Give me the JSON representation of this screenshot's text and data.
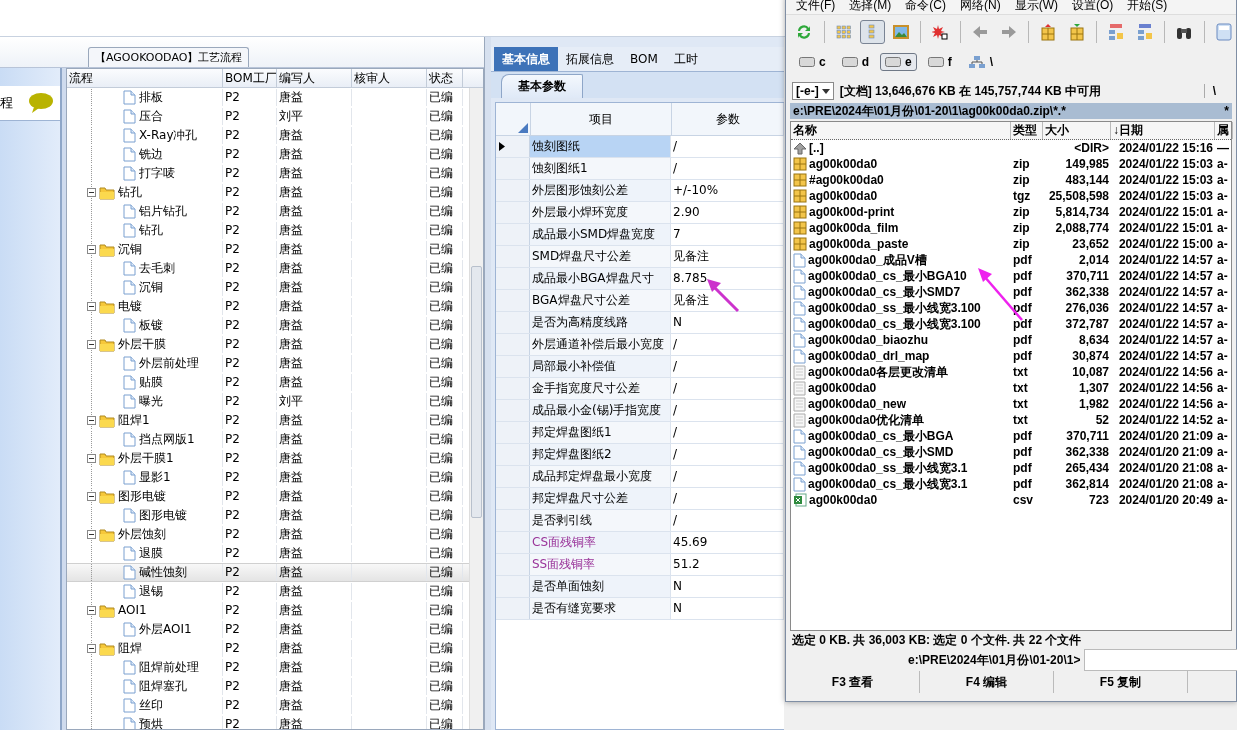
{
  "process_panel": {
    "group_title": "【AGOOKOODAO】工艺流程",
    "side_label": "程",
    "columns": [
      "流程",
      "BOM工厂",
      "编写人",
      "核审人",
      "状态"
    ],
    "tree": [
      {
        "children": [
          {
            "label": "排板",
            "bom": "P2",
            "author": "唐益",
            "status": "已编",
            "selected": false
          },
          {
            "label": "压合",
            "bom": "P2",
            "author": "刘平",
            "status": "已编",
            "selected": false
          },
          {
            "label": "X-Ray冲孔",
            "bom": "P2",
            "author": "唐益",
            "status": "已编",
            "selected": false
          },
          {
            "label": "铣边",
            "bom": "P2",
            "author": "唐益",
            "status": "已编",
            "selected": false
          },
          {
            "label": "打字唛",
            "bom": "P2",
            "author": "唐益",
            "status": "已编",
            "selected": false
          }
        ]
      },
      {
        "label": "钻孔",
        "bom": "P2",
        "author": "唐益",
        "status": "已编",
        "selected": false,
        "expanded": true,
        "children": [
          {
            "label": "铝片钻孔",
            "bom": "P2",
            "author": "唐益",
            "status": "已编",
            "selected": false
          },
          {
            "label": "钻孔",
            "bom": "P2",
            "author": "唐益",
            "status": "已编",
            "selected": false
          }
        ]
      },
      {
        "label": "沉铜",
        "bom": "P2",
        "author": "唐益",
        "status": "已编",
        "selected": false,
        "expanded": true,
        "children": [
          {
            "label": "去毛刺",
            "bom": "P2",
            "author": "唐益",
            "status": "已编",
            "selected": false
          },
          {
            "label": "沉铜",
            "bom": "P2",
            "author": "唐益",
            "status": "已编",
            "selected": false
          }
        ]
      },
      {
        "label": "电镀",
        "bom": "P2",
        "author": "唐益",
        "status": "已编",
        "selected": false,
        "expanded": true,
        "children": [
          {
            "label": "板镀",
            "bom": "P2",
            "author": "唐益",
            "status": "已编",
            "selected": false
          }
        ]
      },
      {
        "label": "外层干膜",
        "bom": "P2",
        "author": "唐益",
        "status": "已编",
        "selected": false,
        "expanded": true,
        "children": [
          {
            "label": "外层前处理",
            "bom": "P2",
            "author": "唐益",
            "status": "已编",
            "selected": false
          },
          {
            "label": "贴膜",
            "bom": "P2",
            "author": "唐益",
            "status": "已编",
            "selected": false
          },
          {
            "label": "曝光",
            "bom": "P2",
            "author": "刘平",
            "status": "已编",
            "selected": false
          }
        ]
      },
      {
        "label": "阻焊1",
        "bom": "P2",
        "author": "唐益",
        "status": "已编",
        "selected": false,
        "expanded": true,
        "children": [
          {
            "label": "挡点网版1",
            "bom": "P2",
            "author": "唐益",
            "status": "已编",
            "selected": false
          }
        ]
      },
      {
        "label": "外层干膜1",
        "bom": "P2",
        "author": "唐益",
        "status": "已编",
        "selected": false,
        "expanded": true,
        "children": [
          {
            "label": "显影1",
            "bom": "P2",
            "author": "唐益",
            "status": "已编",
            "selected": false
          }
        ]
      },
      {
        "label": "图形电镀",
        "bom": "P2",
        "author": "唐益",
        "status": "已编",
        "selected": false,
        "expanded": true,
        "children": [
          {
            "label": "图形电镀",
            "bom": "P2",
            "author": "唐益",
            "status": "已编",
            "selected": false
          }
        ]
      },
      {
        "label": "外层蚀刻",
        "bom": "P2",
        "author": "唐益",
        "status": "已编",
        "selected": false,
        "expanded": true,
        "children": [
          {
            "label": "退膜",
            "bom": "P2",
            "author": "唐益",
            "status": "已编",
            "selected": false
          },
          {
            "label": "碱性蚀刻",
            "bom": "P2",
            "author": "唐益",
            "status": "已编",
            "selected": true
          },
          {
            "label": "退锡",
            "bom": "P2",
            "author": "唐益",
            "status": "已编",
            "selected": false
          }
        ]
      },
      {
        "label": "AOI1",
        "bom": "P2",
        "author": "唐益",
        "status": "已编",
        "selected": false,
        "expanded": true,
        "children": [
          {
            "label": "外层AOI1",
            "bom": "P2",
            "author": "唐益",
            "status": "已编",
            "selected": false
          }
        ]
      },
      {
        "label": "阻焊",
        "bom": "P2",
        "author": "唐益",
        "status": "已编",
        "selected": false,
        "expanded": true,
        "children": [
          {
            "label": "阻焊前处理",
            "bom": "P2",
            "author": "唐益",
            "status": "已编",
            "selected": false
          },
          {
            "label": "阻焊塞孔",
            "bom": "P2",
            "author": "唐益",
            "status": "已编",
            "selected": false
          },
          {
            "label": "丝印",
            "bom": "P2",
            "author": "唐益",
            "status": "已编",
            "selected": false
          },
          {
            "label": "预烘",
            "bom": "P2",
            "author": "唐益",
            "status": "已编",
            "selected": false
          }
        ]
      }
    ]
  },
  "info_panel": {
    "tabs": [
      {
        "label": "基本信息",
        "selected": true
      },
      {
        "label": "拓展信息",
        "selected": false
      },
      {
        "label": "BOM",
        "selected": false
      },
      {
        "label": "工时",
        "selected": false
      }
    ],
    "subtab": "基本参数",
    "columns": [
      "项目",
      "参数"
    ],
    "rows": [
      {
        "item": "蚀刻图纸",
        "value": "/",
        "selected": true,
        "kind": "normal"
      },
      {
        "item": "蚀刻图纸1",
        "value": "/",
        "selected": false,
        "kind": "normal"
      },
      {
        "item": "外层图形蚀刻公差",
        "value": "+/-10%",
        "selected": false,
        "kind": "normal"
      },
      {
        "item": "外层最小焊环宽度",
        "value": "2.90",
        "selected": false,
        "kind": "normal"
      },
      {
        "item": "成品最小SMD焊盘宽度",
        "value": "7",
        "selected": false,
        "kind": "normal"
      },
      {
        "item": "SMD焊盘尺寸公差",
        "value": "见备注",
        "selected": false,
        "kind": "normal"
      },
      {
        "item": "成品最小BGA焊盘尺寸",
        "value": "8.785",
        "selected": false,
        "kind": "normal"
      },
      {
        "item": "BGA焊盘尺寸公差",
        "value": "见备注",
        "selected": false,
        "kind": "normal"
      },
      {
        "item": "是否为高精度线路",
        "value": "N",
        "selected": false,
        "kind": "normal"
      },
      {
        "item": "外层通道补偿后最小宽度",
        "value": "/",
        "selected": false,
        "kind": "normal"
      },
      {
        "item": "局部最小补偿值",
        "value": "/",
        "selected": false,
        "kind": "normal"
      },
      {
        "item": "金手指宽度尺寸公差",
        "value": "/",
        "selected": false,
        "kind": "normal"
      },
      {
        "item": "成品最小金(锡)手指宽度",
        "value": "/",
        "selected": false,
        "kind": "normal"
      },
      {
        "item": "邦定焊盘图纸1",
        "value": "/",
        "selected": false,
        "kind": "normal"
      },
      {
        "item": "邦定焊盘图纸2",
        "value": "/",
        "selected": false,
        "kind": "normal"
      },
      {
        "item": "成品邦定焊盘最小宽度",
        "value": "/",
        "selected": false,
        "kind": "normal"
      },
      {
        "item": "邦定焊盘尺寸公差",
        "value": "/",
        "selected": false,
        "kind": "normal"
      },
      {
        "item": "是否剥引线",
        "value": "/",
        "selected": false,
        "kind": "normal"
      },
      {
        "item": "CS面残铜率",
        "value": "45.69",
        "selected": false,
        "kind": "highlighted"
      },
      {
        "item": "SS面残铜率",
        "value": "51.2",
        "selected": false,
        "kind": "highlighted"
      },
      {
        "item": "是否单面蚀刻",
        "value": "N",
        "selected": false,
        "kind": "normal"
      },
      {
        "item": "是否有缝宽要求",
        "value": "N",
        "selected": false,
        "kind": "normal"
      }
    ]
  },
  "file_manager": {
    "menu": [
      "文件(F)",
      "选择(M)",
      "命令(C)",
      "网络(N)",
      "显示(W)",
      "设置(O)",
      "开始(S)"
    ],
    "toolbar": [
      {
        "kind": "refresh",
        "pressed": false
      },
      {
        "kind": "sep"
      },
      {
        "kind": "grid",
        "pressed": false
      },
      {
        "kind": "list",
        "pressed": true
      },
      {
        "kind": "image",
        "pressed": false
      },
      {
        "kind": "sep"
      },
      {
        "kind": "star",
        "pressed": false
      },
      {
        "kind": "sep"
      },
      {
        "kind": "back",
        "pressed": false
      },
      {
        "kind": "forward",
        "pressed": false
      },
      {
        "kind": "sep"
      },
      {
        "kind": "pack",
        "pressed": false
      },
      {
        "kind": "unpack",
        "pressed": false
      },
      {
        "kind": "sep"
      },
      {
        "kind": "ftp",
        "pressed": false
      },
      {
        "kind": "url",
        "pressed": false
      },
      {
        "kind": "sep"
      },
      {
        "kind": "find",
        "pressed": false
      },
      {
        "kind": "sep"
      },
      {
        "kind": "calc",
        "pressed": false
      }
    ],
    "drives": [
      {
        "label": "c",
        "kind": "disk",
        "selected": false
      },
      {
        "label": "d",
        "kind": "disk",
        "selected": false
      },
      {
        "label": "e",
        "kind": "disk",
        "selected": true
      },
      {
        "label": "f",
        "kind": "disk",
        "selected": false
      },
      {
        "label": "\\",
        "kind": "network",
        "selected": false
      }
    ],
    "drive_select": "[-e-]",
    "free_space": "[文档]  13,646,676 KB 在 145,757,744 KB 中可用",
    "root_button": "\\",
    "path": "e:\\PRE\\2024年\\01月份\\01-20\\1\\ag00k00da0.zip\\*.*",
    "path_right": "*",
    "columns": [
      "名称",
      "类型",
      "大小",
      "↓日期",
      "属"
    ],
    "files": [
      {
        "kind": "up",
        "name": "[..]",
        "size": "<DIR>",
        "date": "2024/01/22 15:16",
        "attr": "—"
      },
      {
        "kind": "archive",
        "name": "ag00k00da0",
        "type": "zip",
        "size": "149,985",
        "date": "2024/01/22 15:03",
        "attr": "a-"
      },
      {
        "kind": "archive",
        "name": "#ag00k00da0",
        "type": "zip",
        "size": "483,144",
        "date": "2024/01/22 15:03",
        "attr": "a-"
      },
      {
        "kind": "archive",
        "name": "ag00k00da0",
        "type": "tgz",
        "size": "25,508,598",
        "date": "2024/01/22 15:03",
        "attr": "a-"
      },
      {
        "kind": "archive",
        "name": "ag00k00d-print",
        "type": "zip",
        "size": "5,814,734",
        "date": "2024/01/22 15:01",
        "attr": "a-"
      },
      {
        "kind": "archive",
        "name": "ag00k00da_film",
        "type": "zip",
        "size": "2,088,774",
        "date": "2024/01/22 15:01",
        "attr": "a-"
      },
      {
        "kind": "archive",
        "name": "ag00k00da_paste",
        "type": "zip",
        "size": "23,652",
        "date": "2024/01/22 15:00",
        "attr": "a-"
      },
      {
        "kind": "doc",
        "name": "ag00k00da0_成品V槽",
        "type": "pdf",
        "size": "2,014",
        "date": "2024/01/22 14:57",
        "attr": "a-"
      },
      {
        "kind": "doc",
        "name": "ag00k00da0_cs_最小BGA10",
        "type": "pdf",
        "size": "370,711",
        "date": "2024/01/22 14:57",
        "attr": "a-"
      },
      {
        "kind": "doc",
        "name": "ag00k00da0_cs_最小SMD7",
        "type": "pdf",
        "size": "362,338",
        "date": "2024/01/22 14:57",
        "attr": "a-"
      },
      {
        "kind": "doc",
        "name": "ag00k00da0_ss_最小线宽3.100",
        "type": "pdf",
        "size": "276,036",
        "date": "2024/01/22 14:57",
        "attr": "a-"
      },
      {
        "kind": "doc",
        "name": "ag00k00da0_cs_最小线宽3.100",
        "type": "pdf",
        "size": "372,787",
        "date": "2024/01/22 14:57",
        "attr": "a-"
      },
      {
        "kind": "doc",
        "name": "ag00k00da0_biaozhu",
        "type": "pdf",
        "size": "8,634",
        "date": "2024/01/22 14:57",
        "attr": "a-"
      },
      {
        "kind": "doc",
        "name": "ag00k00da0_drl_map",
        "type": "pdf",
        "size": "30,874",
        "date": "2024/01/22 14:57",
        "attr": "a-"
      },
      {
        "kind": "text",
        "name": "ag00k00da0各层更改清单",
        "type": "txt",
        "size": "10,087",
        "date": "2024/01/22 14:56",
        "attr": "a-"
      },
      {
        "kind": "text",
        "name": "ag00k00da0",
        "type": "txt",
        "size": "1,307",
        "date": "2024/01/22 14:56",
        "attr": "a-"
      },
      {
        "kind": "text",
        "name": "ag00k00da0_new",
        "type": "txt",
        "size": "1,982",
        "date": "2024/01/22 14:56",
        "attr": "a-"
      },
      {
        "kind": "text",
        "name": "ag00k00da0优化清单",
        "type": "txt",
        "size": "52",
        "date": "2024/01/22 14:52",
        "attr": "a-"
      },
      {
        "kind": "doc",
        "name": "ag00k00da0_cs_最小BGA",
        "type": "pdf",
        "size": "370,711",
        "date": "2024/01/20 21:09",
        "attr": "a-"
      },
      {
        "kind": "doc",
        "name": "ag00k00da0_cs_最小SMD",
        "type": "pdf",
        "size": "362,338",
        "date": "2024/01/20 21:09",
        "attr": "a-"
      },
      {
        "kind": "doc",
        "name": "ag00k00da0_ss_最小线宽3.1",
        "type": "pdf",
        "size": "265,434",
        "date": "2024/01/20 21:08",
        "attr": "a-"
      },
      {
        "kind": "doc",
        "name": "ag00k00da0_cs_最小线宽3.1",
        "type": "pdf",
        "size": "362,814",
        "date": "2024/01/20 21:08",
        "attr": "a-"
      },
      {
        "kind": "sheet",
        "name": "ag00k00da0",
        "type": "csv",
        "size": "723",
        "date": "2024/01/20 20:49",
        "attr": "a-"
      }
    ],
    "status": "选定 0 KB. 共 36,003 KB: 选定 0 个文件. 共 22 个文件",
    "prompt": "e:\\PRE\\2024年\\01月份\\01-20\\1>",
    "function_keys": [
      "F3 查看",
      "F4 编辑",
      "F5 复制"
    ]
  }
}
